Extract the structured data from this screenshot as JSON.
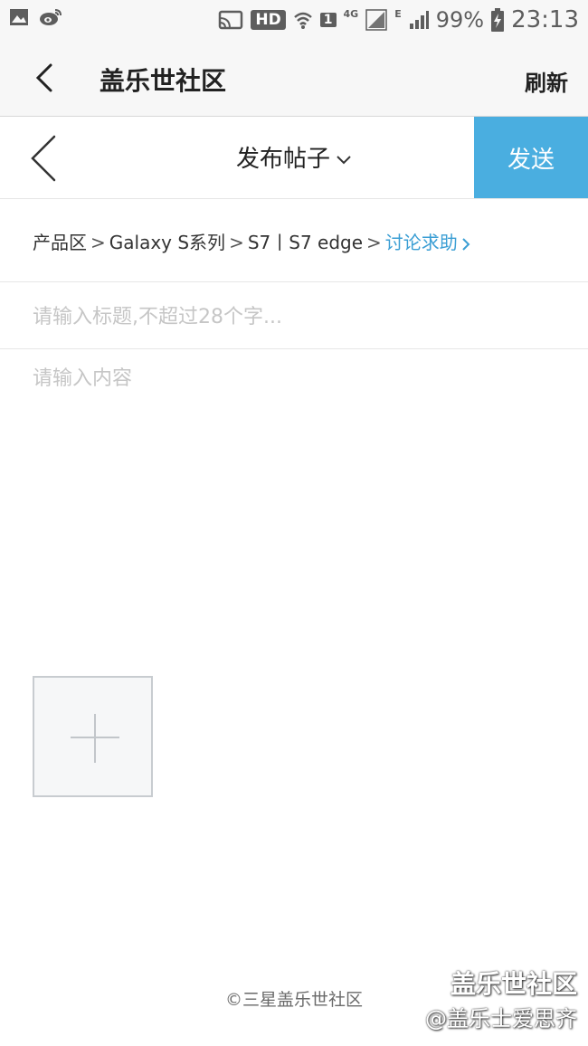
{
  "status_bar": {
    "hd": "HD",
    "sim": "1",
    "net_4g": "4G",
    "net_e": "E",
    "battery": "99%",
    "time": "23:13"
  },
  "app_bar": {
    "title": "盖乐世社区",
    "refresh_label": "刷新"
  },
  "post_bar": {
    "title": "发布帖子",
    "send_label": "发送"
  },
  "breadcrumb": {
    "items": [
      "产品区",
      "Galaxy S系列",
      "S7丨S7 edge"
    ],
    "separator": ">",
    "current": "讨论求助"
  },
  "form": {
    "title_placeholder": "请输入标题,不超过28个字...",
    "title_value": "",
    "content_placeholder": "请输入内容",
    "content_value": ""
  },
  "footer": {
    "copyright": "©三星盖乐世社区"
  },
  "watermark": {
    "line1": "盖乐世社区",
    "line2": "@盖乐士爱思齐"
  },
  "colors": {
    "accent": "#4aaee0",
    "link": "#3a9ed4"
  }
}
